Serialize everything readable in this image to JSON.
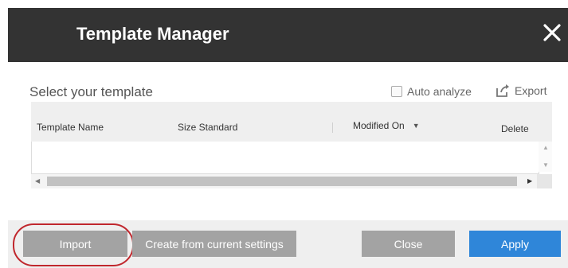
{
  "dialog": {
    "title": "Template Manager",
    "close_icon": "close-icon"
  },
  "toolbar": {
    "select_label": "Select your template",
    "auto_analyze_label": "Auto analyze",
    "auto_analyze_checked": false,
    "export_label": "Export",
    "export_icon": "export-icon"
  },
  "table": {
    "columns": {
      "name": "Template Name",
      "size": "Size Standard",
      "modified": "Modified On",
      "delete": "Delete"
    },
    "sort_icon": "caret-down-icon",
    "rows": []
  },
  "buttons": {
    "import": "Import",
    "create": "Create from current settings",
    "close": "Close",
    "apply": "Apply"
  },
  "colors": {
    "header_bg": "#333333",
    "button_gray": "#a3a3a3",
    "apply_blue": "#2f86d9",
    "annotation_red": "#c0272d"
  }
}
